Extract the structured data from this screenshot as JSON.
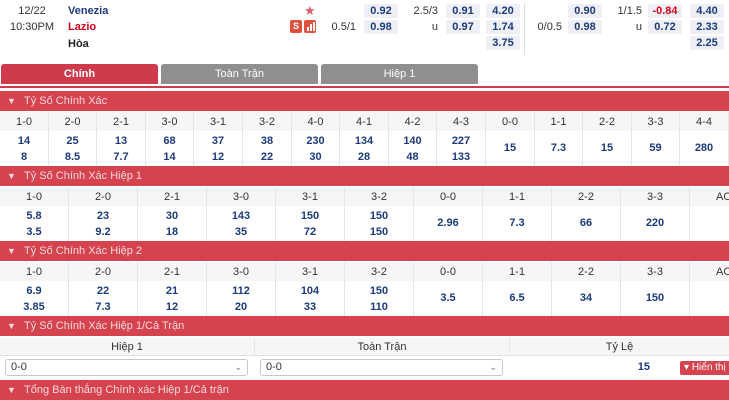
{
  "match": {
    "date": "12/22",
    "time": "10:30PM",
    "home": "Venezia",
    "away": "Lazio",
    "draw": "Hòa",
    "badge_s": "S",
    "full_time": {
      "ah_line": "0.5/1",
      "ah_home": "0.92",
      "ah_away": "0.98",
      "ou_line": "2.5/3",
      "ou_u": "u",
      "ou_over": "0.91",
      "ou_under": "0.97",
      "x12_home": "4.20",
      "x12_away": "1.74",
      "x12_draw": "3.75"
    },
    "first_half": {
      "ah_line": "0/0.5",
      "ah_home": "0.90",
      "ah_away": "0.98",
      "ou_line": "1/1.5",
      "ou_u": "u",
      "ou_over": "-0.84",
      "ou_under": "0.72",
      "x12_home": "4.40",
      "x12_away": "2.33",
      "x12_draw": "2.25"
    }
  },
  "tabs": {
    "main": "Chính",
    "full": "Toàn Trận",
    "half1": "Hiệp 1"
  },
  "sections": {
    "correct_score": "Tỷ Số Chính Xác",
    "correct_score_h1": "Tỷ Số Chính Xác Hiệp 1",
    "correct_score_h2": "Tỷ Số Chính Xác Hiệp 2",
    "correct_score_h1_ft": "Tỷ Số Chính Xác Hiệp 1/Cả Trận",
    "total_goals_h1_ft": "Tổng Bàn thắng Chính xác Hiệp 1/Cả trận"
  },
  "grid_full": {
    "headers": [
      "1-0",
      "2-0",
      "2-1",
      "3-0",
      "3-1",
      "3-2",
      "4-0",
      "4-1",
      "4-2",
      "4-3",
      "0-0",
      "1-1",
      "2-2",
      "3-3",
      "4-4"
    ],
    "top": [
      "14",
      "25",
      "13",
      "68",
      "37",
      "38",
      "230",
      "134",
      "140",
      "227",
      "15",
      "7.3",
      "15",
      "59",
      "280"
    ],
    "bottom": [
      "8",
      "8.5",
      "7.7",
      "14",
      "12",
      "22",
      "30",
      "28",
      "48",
      "133",
      "",
      "",
      "",
      "",
      ""
    ]
  },
  "grid_h1": {
    "headers": [
      "1-0",
      "2-0",
      "2-1",
      "3-0",
      "3-1",
      "3-2",
      "0-0",
      "1-1",
      "2-2",
      "3-3",
      "AO"
    ],
    "top": [
      "5.8",
      "23",
      "30",
      "143",
      "150",
      "150",
      "2.96",
      "7.3",
      "66",
      "220",
      ""
    ],
    "bottom": [
      "3.5",
      "9.2",
      "18",
      "35",
      "72",
      "150",
      "",
      "",
      "",
      "",
      ""
    ]
  },
  "grid_h2": {
    "headers": [
      "1-0",
      "2-0",
      "2-1",
      "3-0",
      "3-1",
      "3-2",
      "0-0",
      "1-1",
      "2-2",
      "3-3",
      "AO"
    ],
    "top": [
      "6.9",
      "22",
      "21",
      "112",
      "104",
      "150",
      "3.5",
      "6.5",
      "34",
      "150",
      ""
    ],
    "bottom": [
      "3.85",
      "7.3",
      "12",
      "20",
      "33",
      "110",
      "",
      "",
      "",
      "",
      ""
    ]
  },
  "hf": {
    "col_h1": "Hiệp 1",
    "col_ft": "Toàn Trận",
    "col_rate": "Tỷ Lệ",
    "h1_value": "0-0",
    "ft_value": "0-0",
    "rate": "15",
    "show_all": "Hiển thị tất cả"
  }
}
